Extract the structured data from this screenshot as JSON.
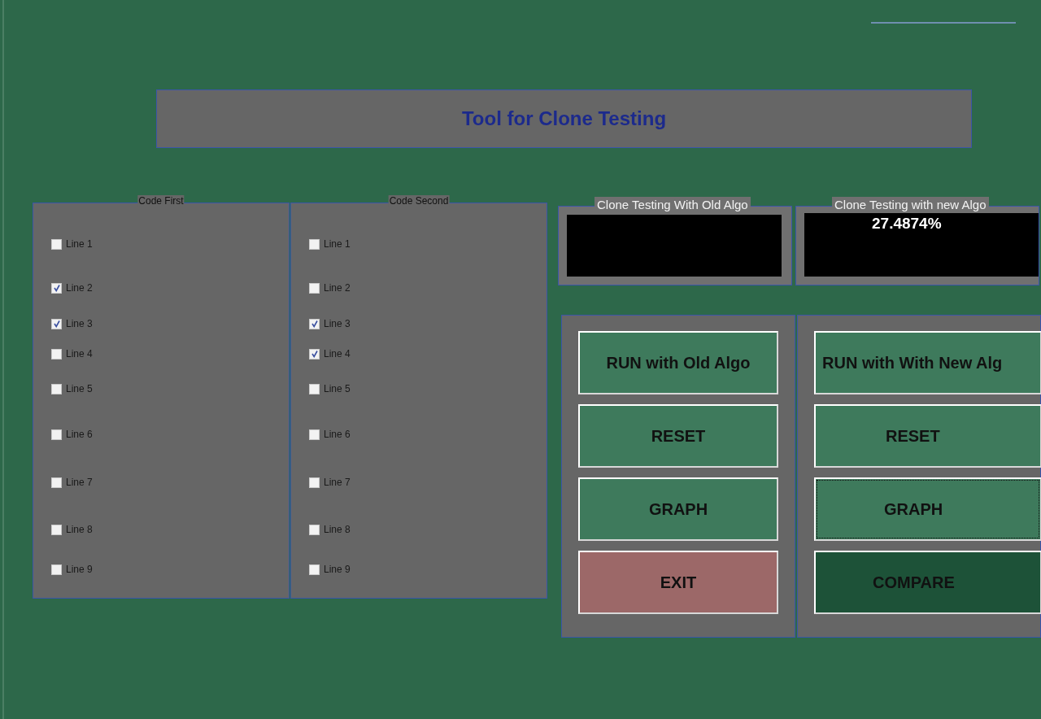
{
  "title": "Tool for Clone Testing",
  "code_panels": [
    {
      "title": "Code First",
      "lines": [
        {
          "label": "Line 1",
          "checked": false
        },
        {
          "label": "Line 2",
          "checked": true
        },
        {
          "label": "Line 3",
          "checked": true
        },
        {
          "label": "Line 4",
          "checked": false
        },
        {
          "label": "Line 5",
          "checked": false
        },
        {
          "label": "Line 6",
          "checked": false
        },
        {
          "label": "Line 7",
          "checked": false
        },
        {
          "label": "Line 8",
          "checked": false
        },
        {
          "label": "Line 9",
          "checked": false
        }
      ]
    },
    {
      "title": "Code Second",
      "lines": [
        {
          "label": "Line 1",
          "checked": false
        },
        {
          "label": "Line 2",
          "checked": false
        },
        {
          "label": "Line 3",
          "checked": true
        },
        {
          "label": "Line 4",
          "checked": true
        },
        {
          "label": "Line 5",
          "checked": false
        },
        {
          "label": "Line 6",
          "checked": false
        },
        {
          "label": "Line 7",
          "checked": false
        },
        {
          "label": "Line 8",
          "checked": false
        },
        {
          "label": "Line 9",
          "checked": false
        }
      ]
    }
  ],
  "results": [
    {
      "title": "Clone Testing With Old Algo"
    },
    {
      "title": "Clone Testing with new Algo",
      "value": "27.4874%"
    }
  ],
  "button_panels": [
    {
      "buttons": [
        {
          "label": "RUN with Old Algo",
          "kind": "normal",
          "focused": false
        },
        {
          "label": "RESET",
          "kind": "normal",
          "focused": false
        },
        {
          "label": "GRAPH",
          "kind": "normal",
          "focused": false
        },
        {
          "label": "EXIT",
          "kind": "exit",
          "focused": false
        }
      ]
    },
    {
      "buttons": [
        {
          "label": "RUN with With New Alg",
          "kind": "normal",
          "focused": false
        },
        {
          "label": "RESET",
          "kind": "normal",
          "focused": false
        },
        {
          "label": "GRAPH",
          "kind": "normal",
          "focused": true
        },
        {
          "label": "COMPARE",
          "kind": "dark",
          "focused": false
        }
      ]
    }
  ]
}
